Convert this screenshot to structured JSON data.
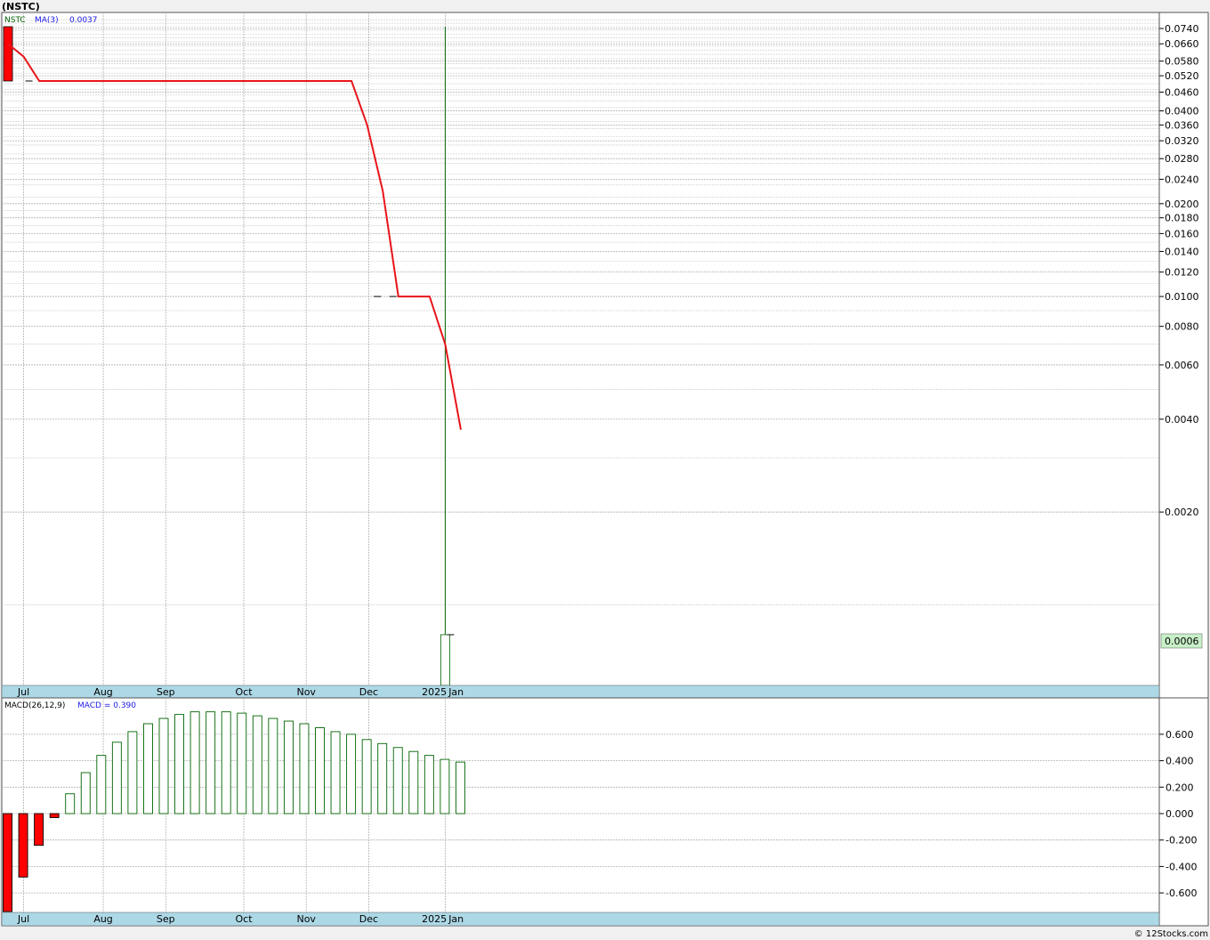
{
  "ticker_header": "(NSTC)",
  "footer": "© 12Stocks.com",
  "price_panel": {
    "legend_symbol": "NSTC",
    "legend_ma": "MA(3)",
    "legend_ma_value": "0.0037",
    "last_price_label": "0.0006",
    "colors": {
      "ma_line": "#e8141a",
      "up_candle": "#006400",
      "down_candle": "#ff0000",
      "axis_band": "#add8e6",
      "last_price_box": "#c8f0c8"
    }
  },
  "macd_panel": {
    "legend_label": "MACD(26,12,9)",
    "legend_value_label": "MACD = 0.390"
  },
  "chart_data": [
    {
      "type": "line",
      "title": "(NSTC)",
      "scale": "log",
      "ylim": [
        0.0004,
        0.085
      ],
      "x_axis_labels": [
        "Jul",
        "Aug",
        "Sep",
        "Oct",
        "Nov",
        "Dec",
        "2025",
        "Jan"
      ],
      "y_ticks": [
        0.074,
        0.066,
        0.058,
        0.052,
        0.046,
        0.04,
        0.036,
        0.032,
        0.028,
        0.024,
        0.02,
        0.018,
        0.016,
        0.014,
        0.012,
        0.01,
        0.008,
        0.006,
        0.004,
        0.002
      ],
      "y_tick_labels": [
        "0.0740",
        "0.0660",
        "0.0580",
        "0.0520",
        "0.0460",
        "0.0400",
        "0.0360",
        "0.0320",
        "0.0280",
        "0.0240",
        "0.0200",
        "0.0180",
        "0.0160",
        "0.0140",
        "0.0120",
        "0.0100",
        "0.0080",
        "0.0060",
        "0.0040",
        "0.0020"
      ],
      "series": [
        {
          "name": "MA(3)",
          "x": [
            0,
            1,
            2,
            22,
            23,
            24,
            25,
            27,
            28,
            29
          ],
          "y": [
            0.066,
            0.06,
            0.05,
            0.05,
            0.036,
            0.022,
            0.01,
            0.01,
            0.007,
            0.0037
          ]
        }
      ],
      "candles": [
        {
          "x": 0,
          "open": 0.075,
          "high": 0.075,
          "low": 0.05,
          "close": 0.05,
          "direction": "down"
        },
        {
          "x": 28,
          "open": 0.0004,
          "high": 0.075,
          "low": 0.0004,
          "close": 0.0008,
          "direction": "up"
        }
      ],
      "price_ticks": [
        {
          "x": 1,
          "value": 0.05,
          "side": "right"
        },
        {
          "x": 24,
          "value": 0.01,
          "side": "left"
        },
        {
          "x": 25,
          "value": 0.01,
          "side": "left"
        },
        {
          "x": 28,
          "value": 0.0008,
          "side": "right"
        }
      ],
      "last_price": 0.0006
    },
    {
      "type": "bar",
      "title": "MACD(26,12,9)",
      "ylim": [
        -0.75,
        0.78
      ],
      "y_ticks": [
        0.6,
        0.4,
        0.2,
        0.0,
        -0.2,
        -0.4,
        -0.6
      ],
      "y_tick_labels": [
        "0.600",
        "0.400",
        "0.200",
        "0.000",
        "-0.200",
        "-0.400",
        "-0.600"
      ],
      "x_axis_labels": [
        "Jul",
        "Aug",
        "Sep",
        "Oct",
        "Nov",
        "Dec",
        "2025",
        "Jan"
      ],
      "series": [
        {
          "name": "MACD",
          "values": [
            -0.76,
            -0.48,
            -0.24,
            -0.03,
            0.15,
            0.31,
            0.44,
            0.54,
            0.62,
            0.68,
            0.72,
            0.75,
            0.77,
            0.77,
            0.77,
            0.76,
            0.74,
            0.72,
            0.7,
            0.68,
            0.65,
            0.62,
            0.6,
            0.56,
            0.53,
            0.5,
            0.47,
            0.44,
            0.41,
            0.39
          ]
        }
      ]
    }
  ]
}
